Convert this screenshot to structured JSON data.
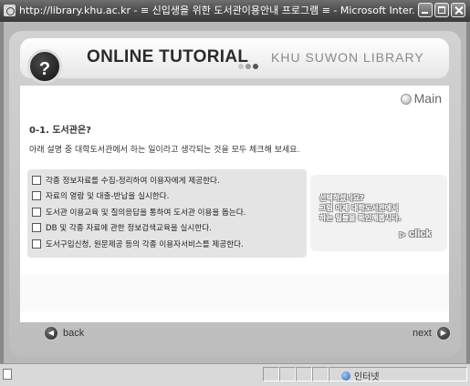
{
  "window": {
    "title": "http://library.khu.ac.kr - ≡ 신입생을 위한 도서관이용안내 프로그램 ≡ - Microsoft Inter..."
  },
  "header": {
    "badge": "?",
    "title": "ONLINE TUTORIAL",
    "subtitle": "KHU SUWON LIBRARY",
    "main_link": "Main"
  },
  "question": {
    "title": "0-1. 도서관은?",
    "description": "아래 설명 중 대학도서관에서 하는 일이라고 생각되는 것을 모두 체크해 보세요.",
    "options": [
      "각종 정보자료를 수집-정리하여 이용자에게 제공한다.",
      "자료의 열람 및 대출-반납을 실시한다.",
      "도서관 이용교육 및 질의응답을 통하여 도서관 이용을 돕는다.",
      "DB 및 각종 자료에 관한 정보검색교육을 실시한다.",
      "도서구입신청, 원문제공 등의 각종 이용자서비스를 제공한다."
    ]
  },
  "hint": {
    "line1": "선택하셨나요?",
    "line2": "그럼 이제 대학도서관에서",
    "line3": "하는 일들을 확인해봅시다.",
    "click_label": "click"
  },
  "nav": {
    "back_label": "back",
    "next_label": "next"
  },
  "statusbar": {
    "zone": "인터넷"
  },
  "colors": {
    "dot_1": "#c8c8c8",
    "dot_2": "#9a9a9a",
    "dot_3": "#555555"
  }
}
